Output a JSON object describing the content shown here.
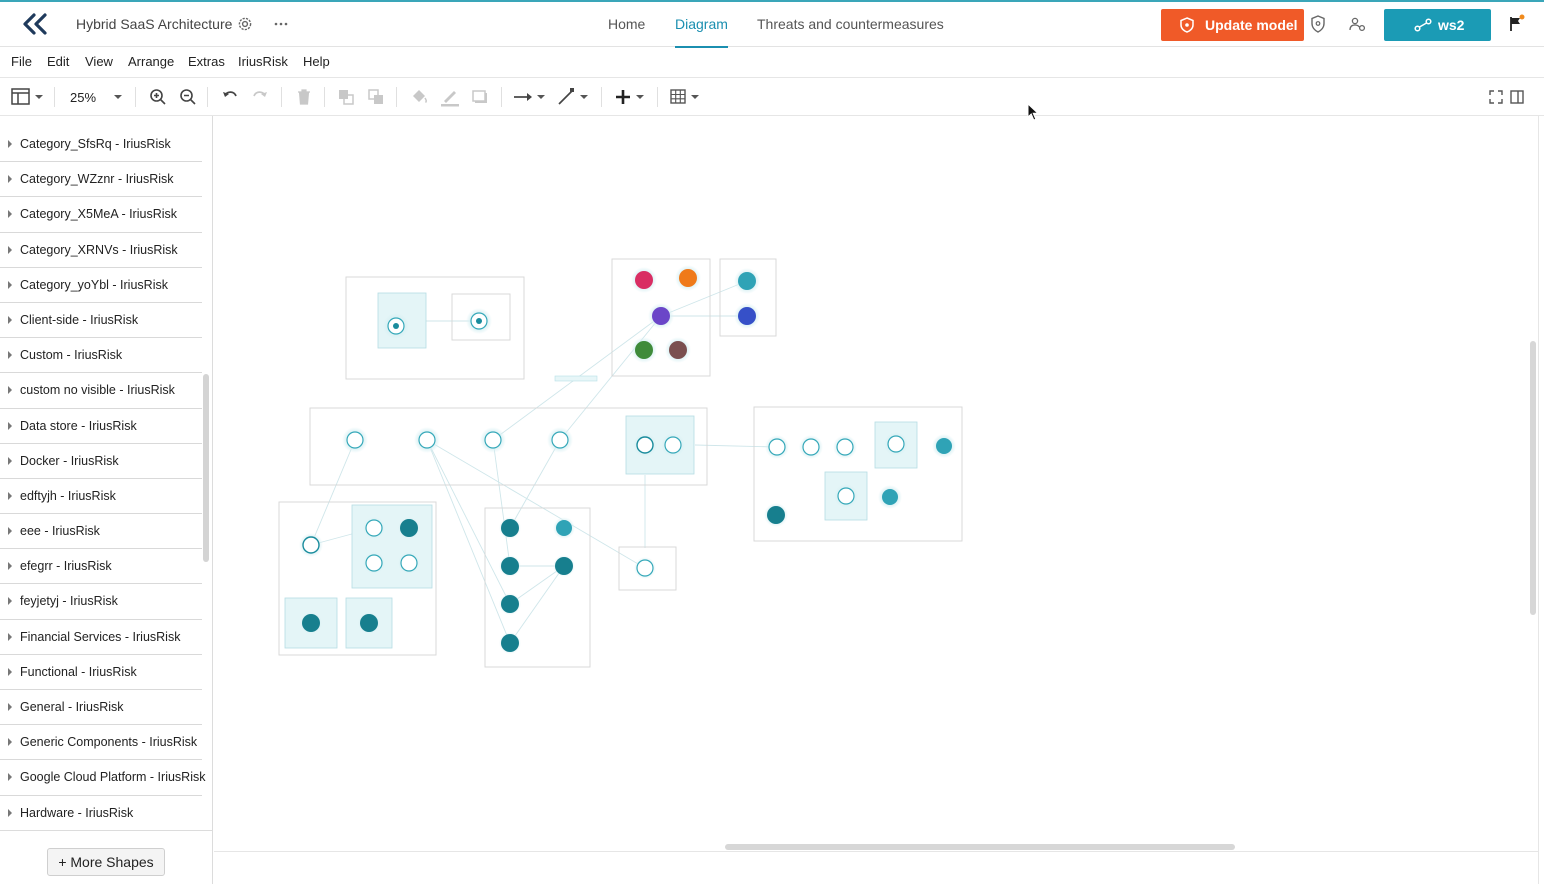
{
  "app": {
    "title": "Hybrid SaaS Architecture"
  },
  "header": {
    "nav": [
      "Home",
      "Diagram",
      "Threats and countermeasures"
    ],
    "active_nav": "Diagram",
    "update_label": "Update model",
    "ws_label": "ws2",
    "colors": {
      "update": "#f05a28",
      "ws": "#1b9bb5",
      "accent": "#1b8fb0"
    }
  },
  "menu": [
    "File",
    "Edit",
    "View",
    "Arrange",
    "Extras",
    "IriusRisk",
    "Help"
  ],
  "toolbar": {
    "zoom": "25%"
  },
  "sidebar": {
    "items": [
      "Category_SfsRq - IriusRisk",
      "Category_WZznr - IriusRisk",
      "Category_X5MeA - IriusRisk",
      "Category_XRNVs - IriusRisk",
      "Category_yoYbl - IriusRisk",
      "Client-side - IriusRisk",
      "Custom - IriusRisk",
      "custom no visible - IriusRisk",
      "Data store - IriusRisk",
      "Docker - IriusRisk",
      "edftyjh - IriusRisk",
      "eee - IriusRisk",
      "efegrr - IriusRisk",
      "feyjetyj - IriusRisk",
      "Financial Services - IriusRisk",
      "Functional - IriusRisk",
      "General - IriusRisk",
      "Generic Components - IriusRisk",
      "Google Cloud Platform - IriusRisk",
      "Hardware - IriusRisk"
    ],
    "more_shapes": "+ More Shapes"
  },
  "diagram": {
    "zoom_note": "diagram rendered at 25% zoom; labels illegible"
  }
}
